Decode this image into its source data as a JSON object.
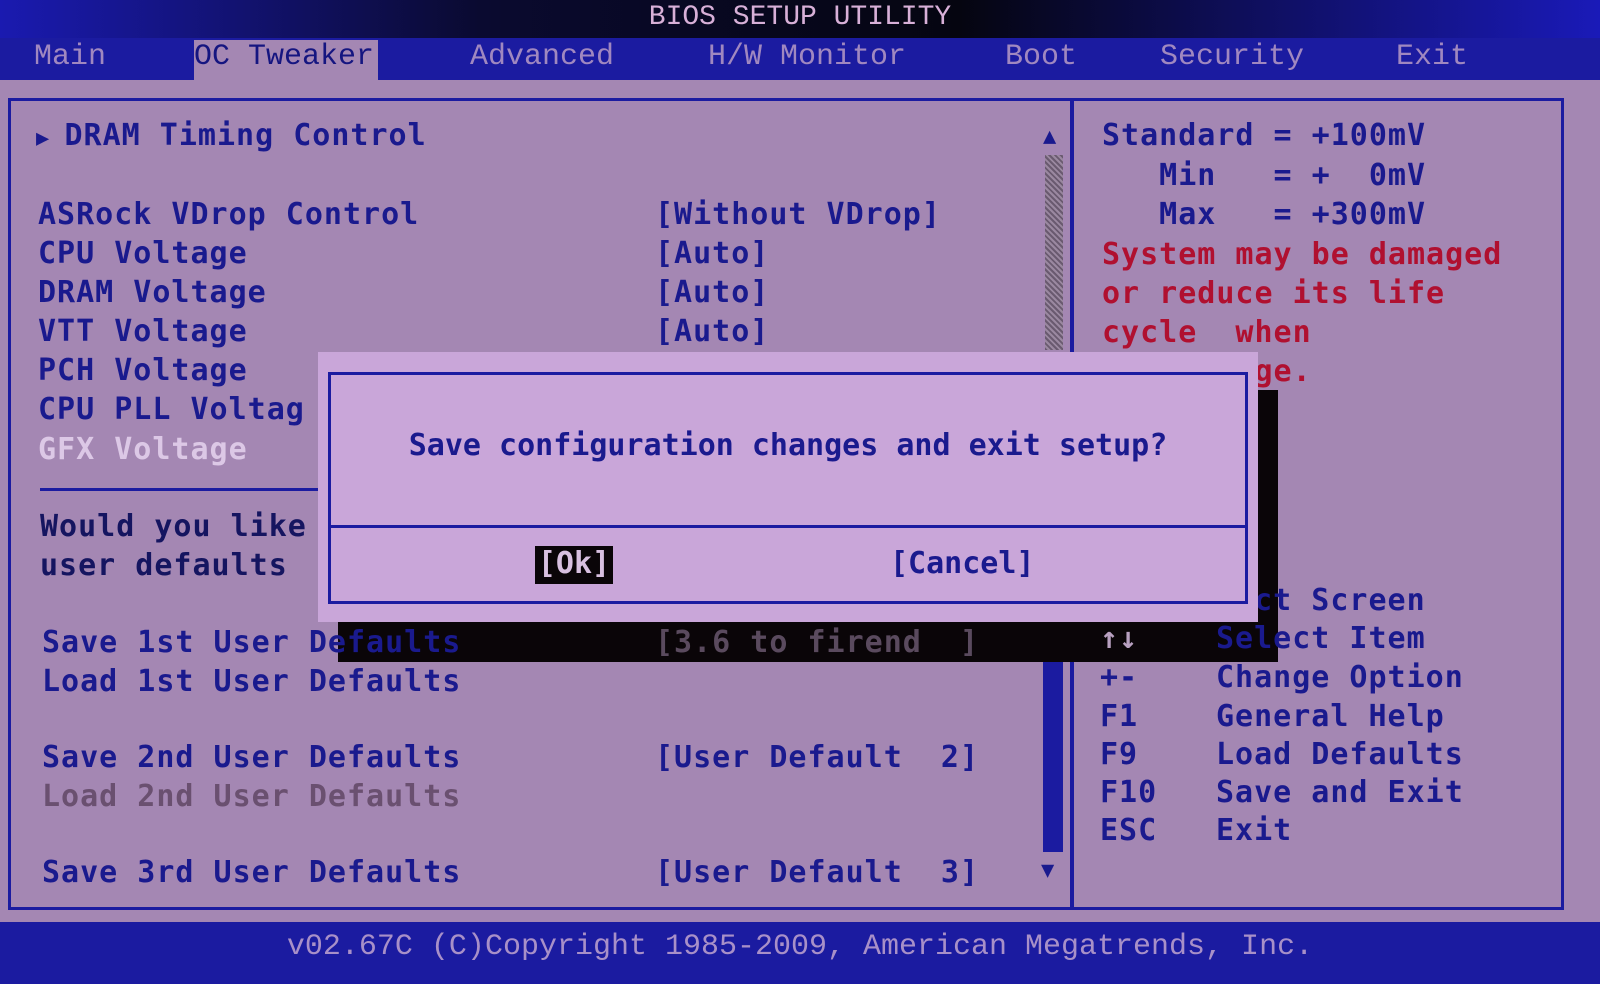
{
  "title": "BIOS SETUP UTILITY",
  "tabs": [
    {
      "label": "Main"
    },
    {
      "label": "OC Tweaker"
    },
    {
      "label": "Advanced"
    },
    {
      "label": "H/W Monitor"
    },
    {
      "label": "Boot"
    },
    {
      "label": "Security"
    },
    {
      "label": "Exit"
    }
  ],
  "active_tab": "OC Tweaker",
  "main": {
    "submenu": "DRAM Timing Control",
    "items": [
      {
        "label": "ASRock VDrop Control",
        "value": "[Without VDrop]"
      },
      {
        "label": "CPU Voltage",
        "value": "[Auto]"
      },
      {
        "label": "DRAM Voltage",
        "value": "[Auto]"
      },
      {
        "label": "VTT Voltage",
        "value": "[Auto]"
      },
      {
        "label": "PCH Voltage",
        "value": ""
      },
      {
        "label": "CPU PLL Voltag",
        "value": ""
      },
      {
        "label": "GFX Voltage",
        "value": ""
      }
    ],
    "question_line1": "Would you like",
    "question_line2": "user defaults",
    "defaults": [
      {
        "label": "Save 1st User Defaults",
        "value": "[3.6 to firend  ]"
      },
      {
        "label": "Load 1st User Defaults",
        "value": ""
      },
      {
        "label": "Save 2nd User Defaults",
        "value": "[User Default  2]"
      },
      {
        "label": "Load 2nd User Defaults",
        "value": ""
      },
      {
        "label": "Save 3rd User Defaults",
        "value": "[User Default  3]"
      }
    ]
  },
  "help": {
    "standard": "Standard = +100mV",
    "min": "   Min   = +  0mV",
    "max": "   Max   = +300mV",
    "warning": [
      "System may be damaged",
      "or reduce its life",
      "cycle  when",
      "       age."
    ],
    "keys": [
      {
        "key": "",
        "desc": "lect Screen"
      },
      {
        "key": "↑↓",
        "desc": "Select Item"
      },
      {
        "key": "+-",
        "desc": "Change Option"
      },
      {
        "key": "F1",
        "desc": "General Help"
      },
      {
        "key": "F9",
        "desc": "Load Defaults"
      },
      {
        "key": "F10",
        "desc": "Save and Exit"
      },
      {
        "key": "ESC",
        "desc": "Exit"
      }
    ]
  },
  "dialog": {
    "message": "Save configuration changes and exit setup?",
    "ok": "[Ok]",
    "cancel": "[Cancel]"
  },
  "footer": "v02.67C (C)Copyright 1985-2009, American Megatrends, Inc.",
  "colors": {
    "background": "#a487b3",
    "text": "#1a1a8e",
    "accent": "#1b1ba0",
    "warning": "#b01030",
    "dialog": "#c9a6d9"
  }
}
